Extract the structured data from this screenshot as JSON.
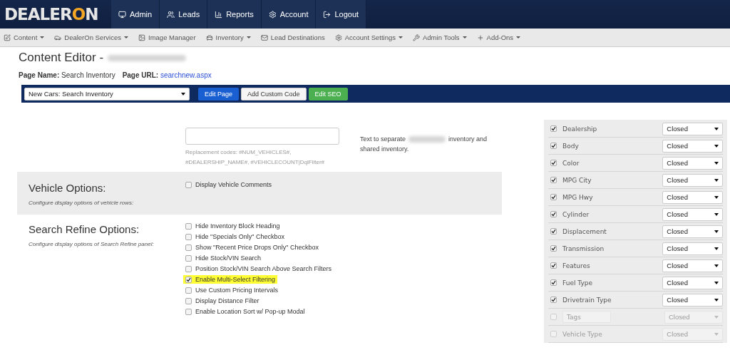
{
  "logo": {
    "text": "DEALER",
    "accent": "O",
    "tail": "N"
  },
  "top_nav": [
    {
      "label": "Admin"
    },
    {
      "label": "Leads"
    },
    {
      "label": "Reports"
    },
    {
      "label": "Account"
    },
    {
      "label": "Logout"
    }
  ],
  "menu": [
    {
      "label": "Content",
      "caret": true
    },
    {
      "label": "DealerOn Services",
      "caret": true
    },
    {
      "label": "Image Manager",
      "caret": false
    },
    {
      "label": "Inventory",
      "caret": true
    },
    {
      "label": "Lead Destinations",
      "caret": false
    },
    {
      "label": "Account Settings",
      "caret": true
    },
    {
      "label": "Admin Tools",
      "caret": true
    },
    {
      "label": "Add-Ons",
      "caret": true
    }
  ],
  "page_title": "Content Editor -",
  "page_name": {
    "label": "Page Name:",
    "value": "Search Inventory"
  },
  "page_url": {
    "label": "Page URL:",
    "value": "searchnew.aspx"
  },
  "page_select": "New Cars: Search Inventory",
  "toolbar_buttons": [
    {
      "label": "Edit Page",
      "kind": "primary"
    },
    {
      "label": "Add Custom Code",
      "kind": "default"
    },
    {
      "label": "Edit SEO",
      "kind": "success"
    }
  ],
  "separator_field": {
    "help": "Replacement codes: #NUM_VEHICLES#, #DEALERSHIP_NAME#, #VEHICLECOUNT|DqlFilter#",
    "note_start": "Text to separate",
    "note_mid": "inventory and",
    "note_end": "shared inventory."
  },
  "sections": [
    {
      "title": "Vehicle Options:",
      "subtitle": "Configure display options of vehicle rows:",
      "shaded": true,
      "options": [
        {
          "label": "Display Vehicle Comments",
          "checked": false,
          "highlighted": false
        }
      ]
    },
    {
      "title": "Search Refine Options:",
      "subtitle": "Configure display options of Search Refine panel:",
      "shaded": false,
      "options": [
        {
          "label": "Hide Inventory Block Heading",
          "checked": false,
          "highlighted": false
        },
        {
          "label": "Hide \"Specials Only\" Checkbox",
          "checked": false,
          "highlighted": false
        },
        {
          "label": "Show \"Recent Price Drops Only\" Checkbox",
          "checked": false,
          "highlighted": false
        },
        {
          "label": "Hide Stock/VIN Search",
          "checked": false,
          "highlighted": false
        },
        {
          "label": "Position Stock/VIN Search Above Search Filters",
          "checked": false,
          "highlighted": false
        },
        {
          "label": "Enable Multi-Select Filtering",
          "checked": true,
          "highlighted": true
        },
        {
          "label": "Use Custom Pricing Intervals",
          "checked": false,
          "highlighted": false
        },
        {
          "label": "Display Distance Filter",
          "checked": false,
          "highlighted": false
        },
        {
          "label": "Enable Location Sort w/ Pop-up Modal",
          "checked": false,
          "highlighted": false
        }
      ]
    }
  ],
  "filters": [
    {
      "kind": "label",
      "label": "Dealership",
      "checked": true,
      "disabled": false,
      "state": "Closed"
    },
    {
      "kind": "label",
      "label": "Body",
      "checked": true,
      "disabled": false,
      "state": "Closed"
    },
    {
      "kind": "label",
      "label": "Color",
      "checked": true,
      "disabled": false,
      "state": "Closed"
    },
    {
      "kind": "label",
      "label": "MPG City",
      "checked": true,
      "disabled": false,
      "state": "Closed"
    },
    {
      "kind": "label",
      "label": "MPG Hwy",
      "checked": true,
      "disabled": false,
      "state": "Closed"
    },
    {
      "kind": "label",
      "label": "Cylinder",
      "checked": true,
      "disabled": false,
      "state": "Closed"
    },
    {
      "kind": "label",
      "label": "Displacement",
      "checked": true,
      "disabled": false,
      "state": "Closed"
    },
    {
      "kind": "label",
      "label": "Transmission",
      "checked": true,
      "disabled": false,
      "state": "Closed"
    },
    {
      "kind": "label",
      "label": "Features",
      "checked": true,
      "disabled": false,
      "state": "Closed"
    },
    {
      "kind": "label",
      "label": "Fuel Type",
      "checked": true,
      "disabled": false,
      "state": "Closed"
    },
    {
      "kind": "label",
      "label": "Drivetrain Type",
      "checked": true,
      "disabled": false,
      "state": "Closed"
    },
    {
      "kind": "field",
      "placeholder": "Tags",
      "checked": false,
      "disabled": true,
      "state": "Closed"
    },
    {
      "kind": "label",
      "label": "Vehicle Type",
      "checked": false,
      "disabled": true,
      "state": "Closed"
    }
  ]
}
